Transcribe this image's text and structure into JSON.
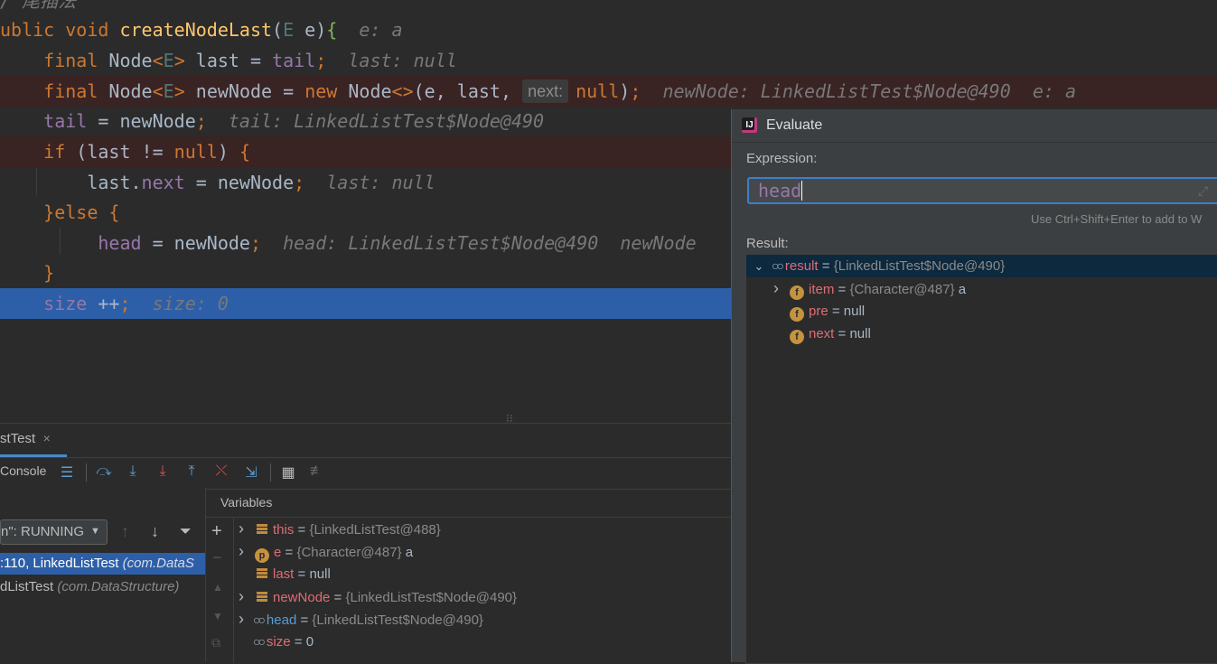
{
  "editor": {
    "lines": [
      {
        "segs": [
          [
            "hint",
            "/ 尾插法"
          ]
        ]
      },
      {
        "segs": [
          [
            "kw",
            "ublic void "
          ],
          [
            "fn",
            "createNodeLast"
          ],
          [
            "plain",
            "("
          ],
          [
            "tp",
            "E"
          ],
          [
            "plain",
            " e)"
          ],
          [
            "brace-g",
            "{"
          ],
          [
            "hint",
            "  e: a"
          ]
        ]
      },
      {
        "segs": [
          [
            "kw",
            "    final "
          ],
          [
            "ty",
            "Node"
          ],
          [
            "kw",
            "<"
          ],
          [
            "tp",
            "E"
          ],
          [
            "kw",
            "> "
          ],
          [
            "plain",
            "last = "
          ],
          [
            "fld",
            "tail"
          ],
          [
            "kw",
            ";"
          ],
          [
            "hint",
            "  last: null"
          ]
        ]
      },
      {
        "segs": [
          [
            "kw",
            "    final "
          ],
          [
            "ty",
            "Node"
          ],
          [
            "kw",
            "<"
          ],
          [
            "tp",
            "E"
          ],
          [
            "kw",
            "> "
          ],
          [
            "plain",
            "newNode = "
          ],
          [
            "kw",
            "new "
          ],
          [
            "ty",
            "Node"
          ],
          [
            "kw",
            "<>"
          ],
          [
            "plain",
            "(e, last, "
          ]
        ]
      },
      {
        "segs": [
          [
            "fld",
            "    tail"
          ],
          [
            "plain",
            " = newNode"
          ],
          [
            "kw",
            ";"
          ],
          [
            "hint",
            "  tail: LinkedListTest$Node@490"
          ]
        ]
      },
      {
        "segs": [
          [
            "kw",
            "    if "
          ],
          [
            "plain",
            "(last != "
          ],
          [
            "kw",
            "null"
          ],
          [
            "plain",
            ") "
          ],
          [
            "kw",
            "{"
          ]
        ]
      },
      {
        "segs": [
          [
            "plain",
            "        last."
          ],
          [
            "fld",
            "next"
          ],
          [
            "plain",
            " = newNode"
          ],
          [
            "kw",
            ";"
          ],
          [
            "hint",
            "  last: null"
          ]
        ]
      },
      {
        "segs": [
          [
            "kw",
            "    }else {"
          ]
        ]
      },
      {
        "segs": [
          [
            "fld",
            "         head"
          ],
          [
            "plain",
            " = newNode"
          ],
          [
            "kw",
            ";"
          ],
          [
            "hint",
            "  head: LinkedListTest$Node@490  newNode"
          ]
        ]
      },
      {
        "segs": [
          [
            "kw",
            "    }"
          ]
        ]
      },
      {
        "segs": [
          [
            "fld",
            "    size "
          ],
          [
            "plain",
            "++"
          ],
          [
            "kw",
            ";"
          ],
          [
            "hint",
            "  size: 0"
          ]
        ]
      }
    ],
    "param_hint": "next:",
    "line4_tail": [
      [
        "kw",
        "null"
      ],
      [
        "plain",
        ")"
      ],
      [
        "kw",
        ";"
      ],
      [
        "hint",
        "  newNode: LinkedListTest$Node@490  e: a"
      ]
    ]
  },
  "debug": {
    "tab_label": "stTest",
    "tab_close": "×",
    "console_label": "Console",
    "variables_title": "Variables",
    "thread_select": "n\": RUNNING",
    "frames": [
      {
        "method": ":110, LinkedListTest",
        "pkg": " (com.DataS"
      },
      {
        "method": "dListTest",
        "pkg": " (com.DataStructure)"
      }
    ],
    "variables": [
      {
        "expand": true,
        "icon": "list",
        "name": "this",
        "val": " = ",
        "grey": "{LinkedListTest@488}",
        "tail": ""
      },
      {
        "expand": true,
        "icon": "p",
        "name": "e",
        "val": " = ",
        "grey": "{Character@487}",
        "tail": " a"
      },
      {
        "expand": false,
        "icon": "list",
        "name": "last",
        "val": " = null",
        "grey": "",
        "tail": ""
      },
      {
        "expand": true,
        "icon": "list",
        "name": "newNode",
        "val": " = ",
        "grey": "{LinkedListTest$Node@490}",
        "tail": ""
      },
      {
        "expand": true,
        "icon": "watch",
        "name": "head",
        "val": " = ",
        "grey": "{LinkedListTest$Node@490}",
        "tail": ""
      },
      {
        "expand": false,
        "icon": "watch",
        "name": "size",
        "val": " = 0",
        "grey": "",
        "tail": ""
      }
    ]
  },
  "evaluate": {
    "title": "Evaluate",
    "expression_label": "Expression:",
    "expression_value": "head",
    "hint": "Use Ctrl+Shift+Enter to add to W",
    "result_label": "Result:",
    "result_root": {
      "name": "result",
      "val": " = ",
      "grey": "{LinkedListTest$Node@490}"
    },
    "result_children": [
      {
        "expand": true,
        "name": "item",
        "val": " = ",
        "grey": "{Character@487}",
        "tail": " a"
      },
      {
        "expand": false,
        "name": "pre",
        "val": " = null",
        "grey": "",
        "tail": ""
      },
      {
        "expand": false,
        "name": "next",
        "val": " = null",
        "grey": "",
        "tail": ""
      }
    ]
  },
  "colors": {
    "accent": "#2d5fa8",
    "error_line": "#3a2323",
    "field": "#9876aa",
    "keyword": "#cc7832"
  }
}
